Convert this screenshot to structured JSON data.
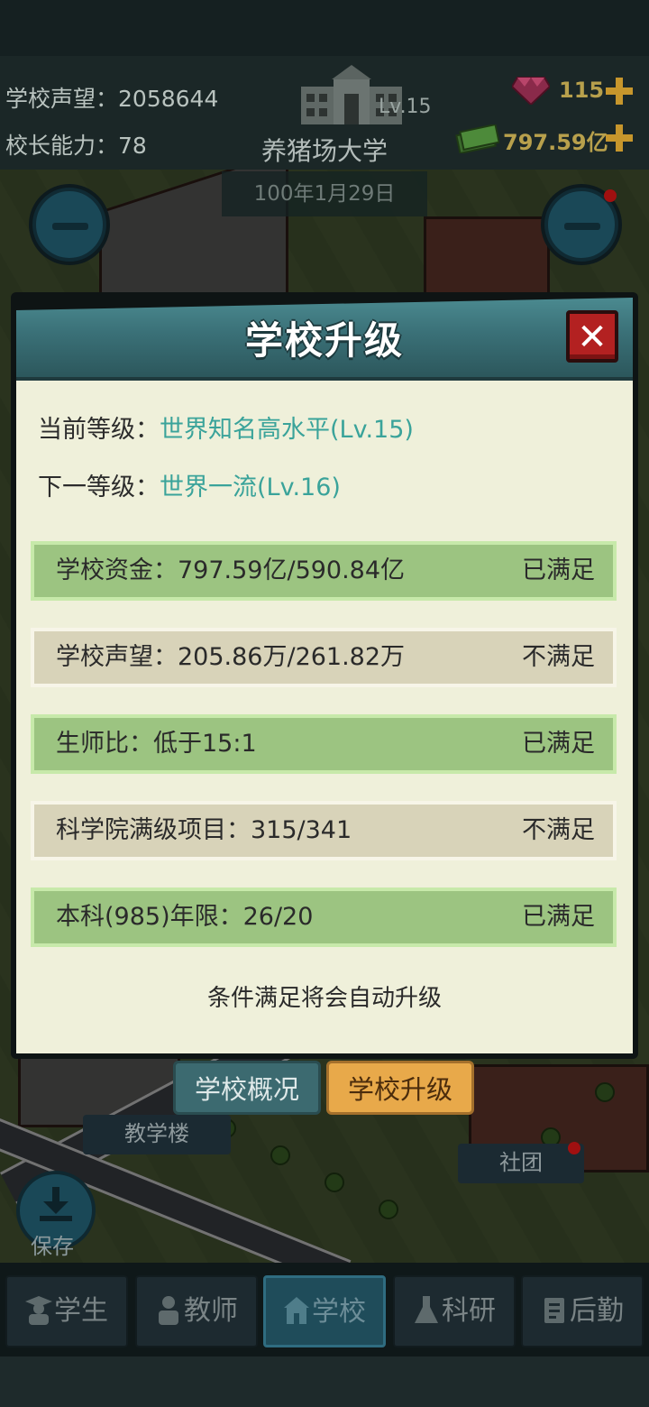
{
  "hud": {
    "reputation_label": "学校声望：",
    "reputation_value": "2058644",
    "ability_label": "校长能力：",
    "ability_value": "78",
    "level": "Lv.15",
    "school_name": "养猪场大学",
    "gems": "115",
    "money": "797.59亿",
    "date": "100年1月29日"
  },
  "modal": {
    "title": "学校升级",
    "current_level_label": "当前等级：",
    "current_level_value": "世界知名高水平(Lv.15)",
    "next_level_label": "下一等级：",
    "next_level_value": "世界一流(Lv.16)",
    "conditions": [
      {
        "label": "学校资金：797.59亿/590.84亿",
        "status": "已满足",
        "met": true
      },
      {
        "label": "学校声望：205.86万/261.82万",
        "status": "不满足",
        "met": false
      },
      {
        "label": "生师比：低于15:1",
        "status": "已满足",
        "met": true
      },
      {
        "label": "科学院满级项目：315/341",
        "status": "不满足",
        "met": false
      },
      {
        "label": "本科(985)年限：26/20",
        "status": "已满足",
        "met": true
      }
    ],
    "footer_note": "条件满足将会自动升级"
  },
  "tabs": {
    "overview": "学校概况",
    "upgrade": "学校升级"
  },
  "map_labels": {
    "teaching_building": "教学楼",
    "club": "社团",
    "save": "保存"
  },
  "bottom_nav": [
    {
      "label": "学生",
      "icon": "student-icon"
    },
    {
      "label": "教师",
      "icon": "teacher-icon"
    },
    {
      "label": "学校",
      "icon": "school-icon"
    },
    {
      "label": "科研",
      "icon": "research-icon"
    },
    {
      "label": "后勤",
      "icon": "logistics-icon"
    }
  ],
  "colors": {
    "met_row": "#9cc481",
    "unmet_row": "#d8d3b9",
    "level_value": "#3aa39a",
    "close_button": "#b32121",
    "upgrade_tab": "#e8a94a"
  }
}
